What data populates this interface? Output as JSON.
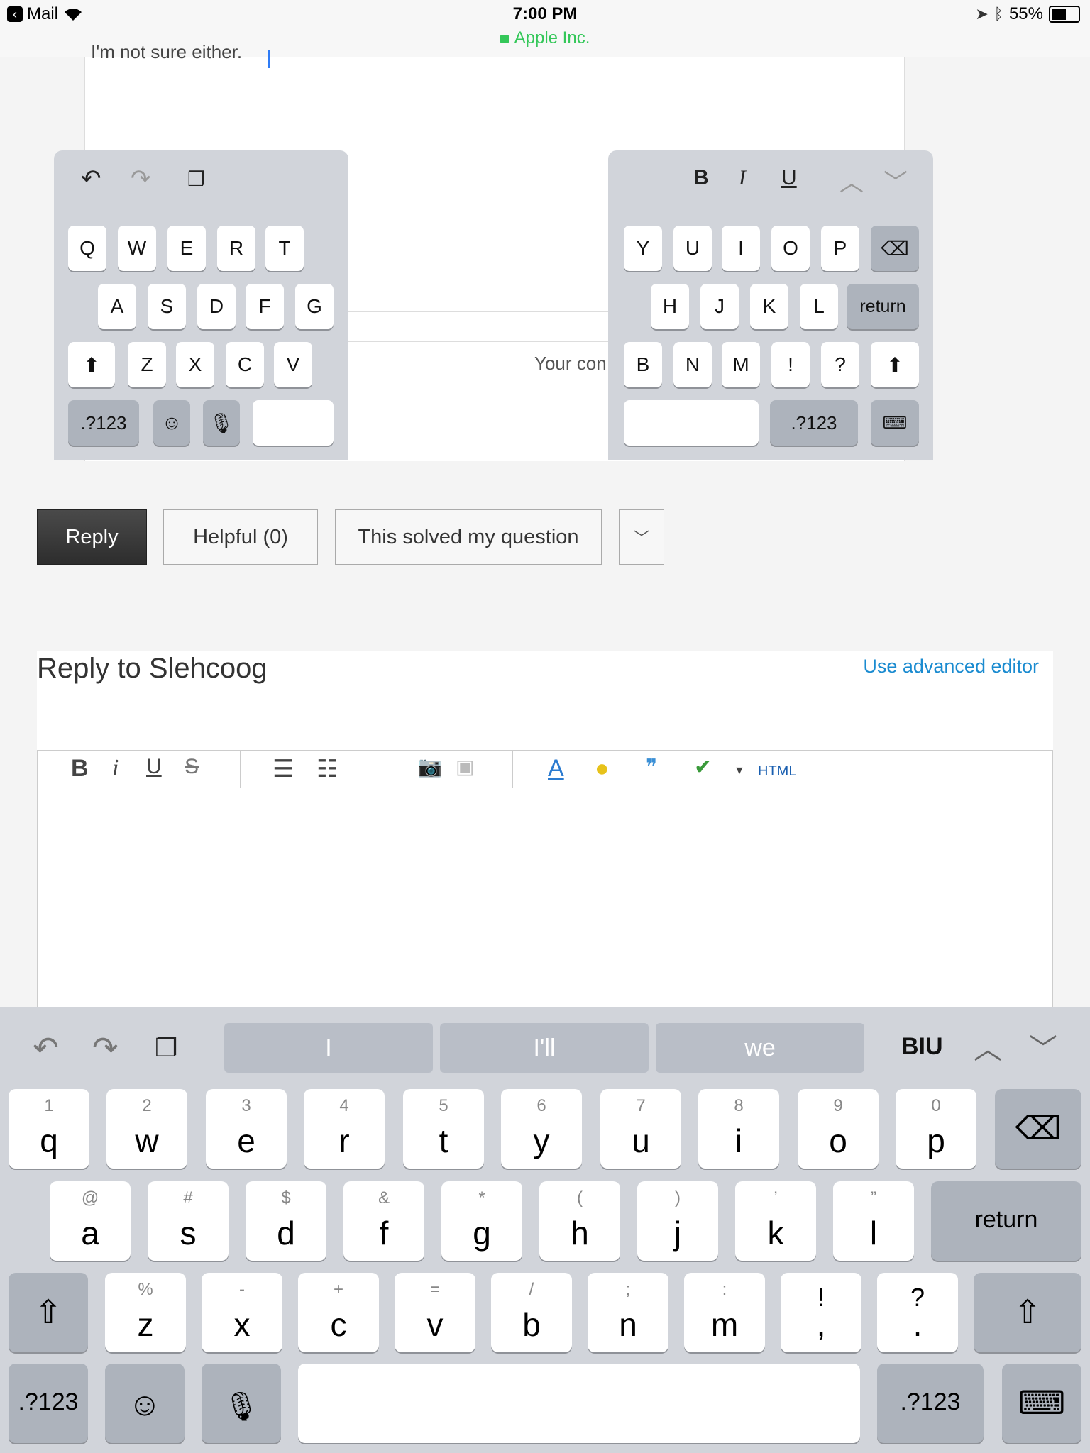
{
  "status_bar": {
    "back_app": "Mail",
    "time": "7:00 PM",
    "site": "Apple Inc.",
    "battery": "55%"
  },
  "old_reply": {
    "text": "I'm not sure either.",
    "placeholder_partial": "Your con"
  },
  "split_keyboard": {
    "left_rows": [
      [
        "Q",
        "W",
        "E",
        "R",
        "T"
      ],
      [
        "A",
        "S",
        "D",
        "F",
        "G"
      ],
      [
        "Z",
        "X",
        "C",
        "V"
      ]
    ],
    "right_rows": [
      [
        "Y",
        "U",
        "I",
        "O",
        "P"
      ],
      [
        "H",
        "J",
        "K",
        "L"
      ],
      [
        "B",
        "N",
        "M",
        "!",
        "?"
      ]
    ],
    "numbers_label": ".?123",
    "return_label": "return",
    "format_b": "B",
    "format_i": "I",
    "format_u": "U"
  },
  "actions": {
    "reply": "Reply",
    "helpful": "Helpful (0)",
    "solved": "This solved my question"
  },
  "reply_box": {
    "title": "Reply to Slehcoog",
    "advanced_link": "Use advanced editor",
    "toolbar": {
      "bold": "B",
      "italic": "i",
      "underline": "U",
      "strike": "S",
      "html": "HTML"
    }
  },
  "keyboard": {
    "suggestions": [
      "I",
      "I'll",
      "we"
    ],
    "format_label": "BIU",
    "row1": [
      [
        "1",
        "q"
      ],
      [
        "2",
        "w"
      ],
      [
        "3",
        "e"
      ],
      [
        "4",
        "r"
      ],
      [
        "5",
        "t"
      ],
      [
        "6",
        "y"
      ],
      [
        "7",
        "u"
      ],
      [
        "8",
        "i"
      ],
      [
        "9",
        "o"
      ],
      [
        "0",
        "p"
      ]
    ],
    "row2": [
      [
        "@",
        "a"
      ],
      [
        "#",
        "s"
      ],
      [
        "$",
        "d"
      ],
      [
        "&",
        "f"
      ],
      [
        "*",
        "g"
      ],
      [
        "(",
        "h"
      ],
      [
        ")",
        "j"
      ],
      [
        "’",
        "k"
      ],
      [
        "”",
        "l"
      ]
    ],
    "row3": [
      [
        "%",
        "z"
      ],
      [
        "-",
        "x"
      ],
      [
        "+",
        "c"
      ],
      [
        "=",
        "v"
      ],
      [
        "/",
        "b"
      ],
      [
        ";",
        "n"
      ],
      [
        ":",
        "m"
      ],
      [
        "!",
        ","
      ],
      [
        "?",
        "."
      ]
    ],
    "return_label": "return",
    "numbers_label": ".?123"
  }
}
